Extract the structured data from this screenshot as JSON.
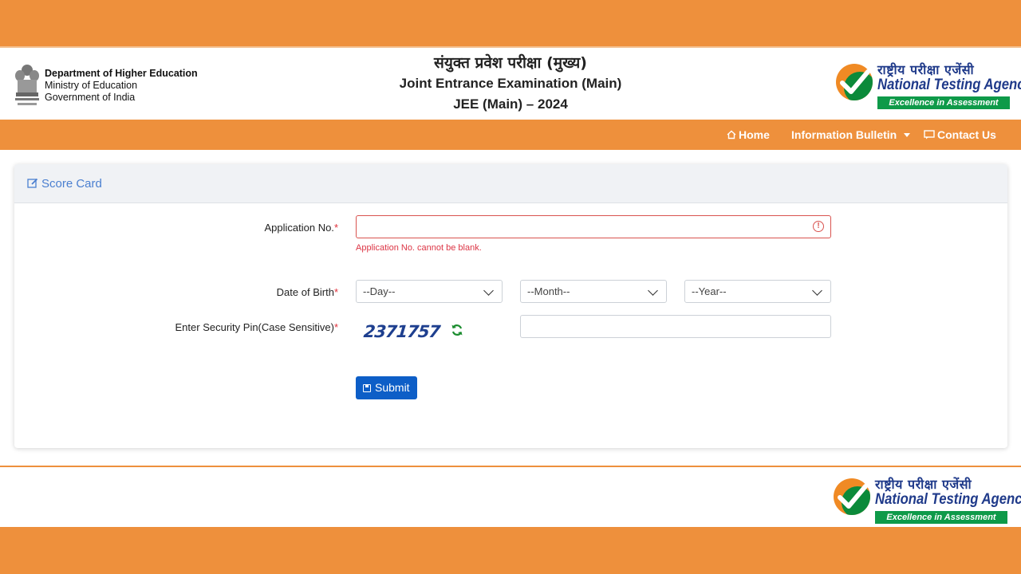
{
  "header": {
    "dept": {
      "line1": "Department of Higher Education",
      "line2": "Ministry of Education",
      "line3": "Government of India"
    },
    "title_hindi": "संयुक्त प्रवेश परीक्षा (मुख्य)",
    "title_english": "Joint Entrance Examination (Main)",
    "title_year": "JEE (Main) – 2024",
    "nta_logo": {
      "hindi": "राष्ट्रीय परीक्षा एजेंसी",
      "english": "National Testing Agency",
      "tagline": "Excellence in Assessment"
    }
  },
  "nav": {
    "home": "Home",
    "info_bulletin": "Information Bulletin",
    "contact": "Contact Us"
  },
  "card": {
    "title": "Score Card",
    "application_label": "Application No.",
    "application_value": "",
    "application_error": "Application No. cannot be blank.",
    "dob_label": "Date of Birth",
    "day_selected": "--Day--",
    "month_selected": "--Month--",
    "year_selected": "--Year--",
    "pin_label": "Enter Security Pin(Case Sensitive)",
    "captcha": "2371757",
    "pin_value": "",
    "submit_label": "Submit",
    "required_mark": "*"
  },
  "footer": {
    "nta_logo": {
      "hindi": "राष्ट्रीय परीक्षा एजेंसी",
      "english": "National Testing Agency",
      "tagline": "Excellence in Assessment"
    }
  },
  "colors": {
    "brand_orange": "#ee903c",
    "link_blue": "#4a7fd0",
    "button_blue": "#0d5ec7",
    "error_red": "#dc3545",
    "nta_green": "#0e9a49"
  }
}
